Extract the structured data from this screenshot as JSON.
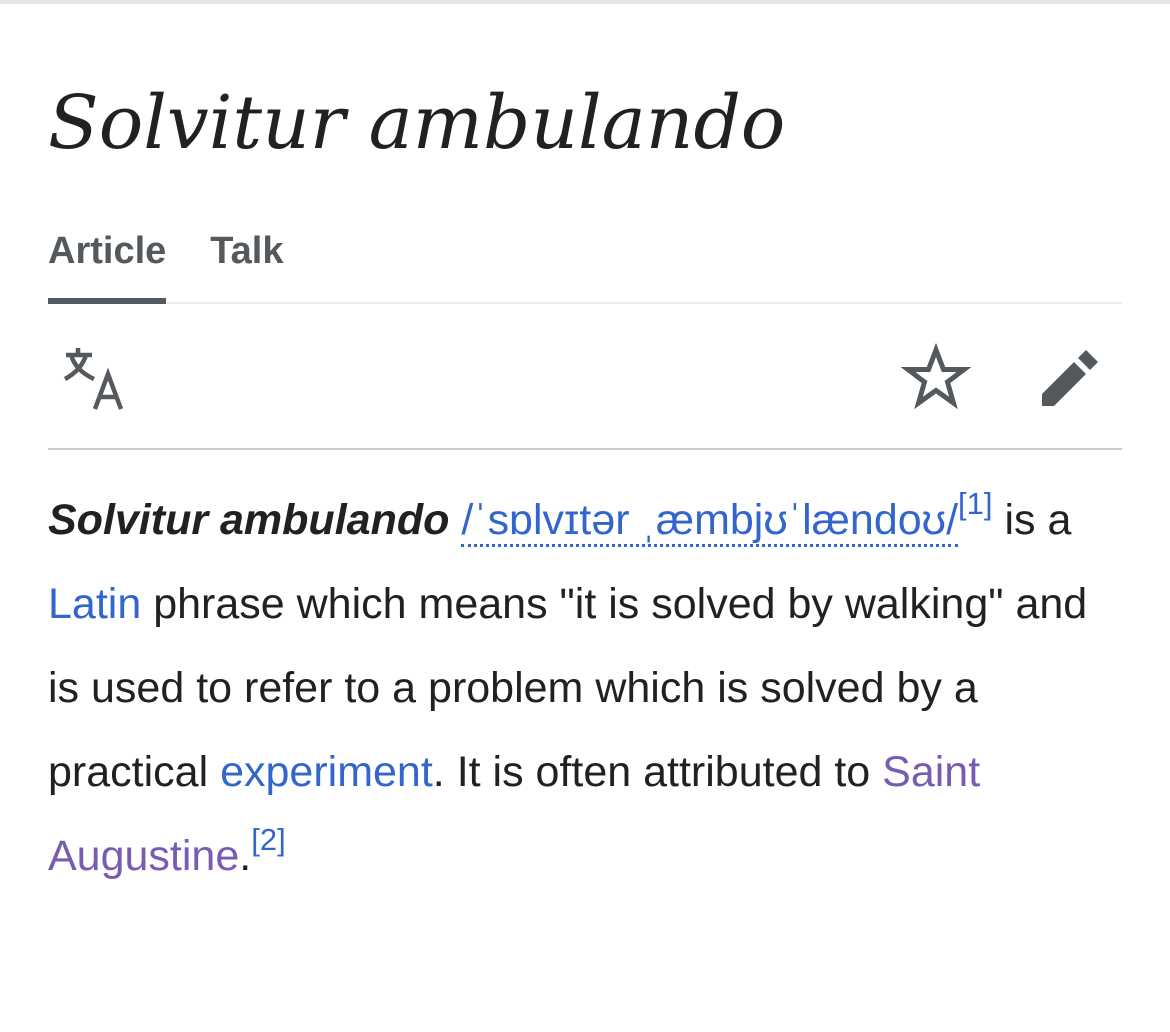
{
  "page": {
    "title": "Solvitur ambulando"
  },
  "tabs": [
    {
      "label": "Article",
      "selected": true
    },
    {
      "label": "Talk",
      "selected": false
    }
  ],
  "toolbar": {
    "language_icon": "translate-icon",
    "watch_icon": "star-outline-icon",
    "edit_icon": "pencil-icon"
  },
  "article": {
    "term": "Solvitur ambulando",
    "ipa_part1": "/ˈsɒlvɪtər",
    "ipa_part2": "ˌæmbjʊˈlændoʊ/",
    "ref1": "[1]",
    "text_a": " is a ",
    "link_latin": "Latin",
    "text_b": " phrase which means \"it is solved by walking\" and is used to refer to a problem which is solved by a practical ",
    "link_experiment": "experiment",
    "text_c": ". It is often attributed to ",
    "link_augustine": "Saint Augustine",
    "text_d": ".",
    "ref2": "[2]"
  },
  "colors": {
    "link": "#3366cc",
    "visited_link": "#795cb2",
    "text": "#202122",
    "tab_text": "#54595d"
  }
}
